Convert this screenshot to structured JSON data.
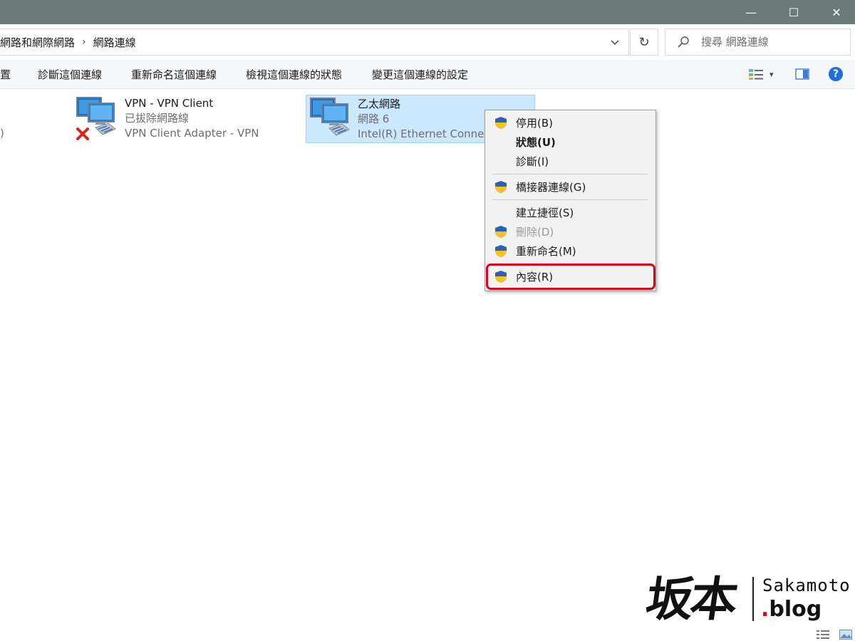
{
  "window": {
    "minimize_glyph": "—",
    "maximize_glyph": "☐",
    "close_glyph": "✕"
  },
  "address": {
    "crumbs": [
      "網路和網際網路",
      "網路連線"
    ],
    "separator": "›",
    "dropdown_glyph": "⌄",
    "refresh_glyph": "↻"
  },
  "search": {
    "placeholder": "搜尋 網路連線"
  },
  "command_bar": {
    "cut_left_label": "置",
    "diagnose": "診斷這個連線",
    "rename": "重新命名這個連線",
    "view_status": "檢視這個連線的狀態",
    "change_settings": "變更這個連線的設定",
    "help_glyph": "?",
    "view_dd_glyph": "▾"
  },
  "left_edge_text": ")",
  "connections": [
    {
      "name": "VPN - VPN Client",
      "status": "已拔除網路線",
      "adapter": "VPN Client Adapter - VPN",
      "disconnected": true,
      "selected": false
    },
    {
      "name": "乙太網路",
      "status": "網路 6",
      "adapter": "Intel(R) Ethernet Connec",
      "disconnected": false,
      "selected": true
    }
  ],
  "context_menu": {
    "items": [
      {
        "label": "停用(B)",
        "shield": true
      },
      {
        "label": "狀態(U)",
        "shield": false,
        "bold": true
      },
      {
        "label": "診斷(I)",
        "shield": false
      },
      {
        "label": "橋接器連線(G)",
        "shield": true
      },
      {
        "label": "建立捷徑(S)",
        "shield": false
      },
      {
        "label": "刪除(D)",
        "shield": true,
        "disabled": true
      },
      {
        "label": "重新命名(M)",
        "shield": true
      },
      {
        "label": "內容(R)",
        "shield": true,
        "highlighted": true
      }
    ],
    "highlight_color": "#e0001a"
  },
  "watermark": {
    "kanji": "坂本",
    "site": "Sakamoto",
    "dot": ".",
    "blog": "blog"
  },
  "colors": {
    "titlebar": "#6b7b7a",
    "selection": "#cce8ff",
    "help_blue": "#1e6fd9"
  }
}
